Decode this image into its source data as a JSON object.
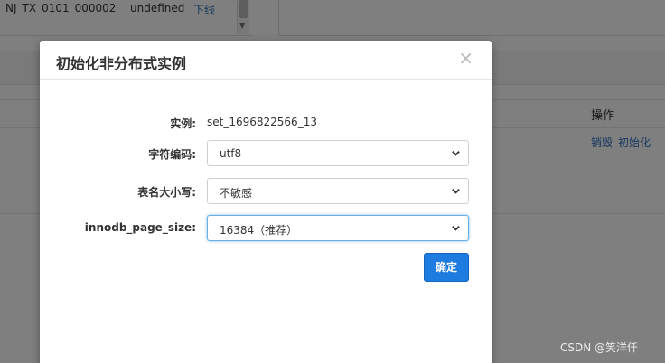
{
  "background": {
    "top_row": {
      "col1": "_NJ_TX_0101_000002",
      "col2": "undefined",
      "col3_link": "下线"
    },
    "table_header_ops": "操作",
    "row_actions": [
      "销毁",
      "初始化"
    ]
  },
  "modal": {
    "title": "初始化非分布式实例",
    "close_symbol": "×",
    "fields": {
      "instance": {
        "label": "实例:",
        "value": "set_1696822566_13"
      },
      "charset": {
        "label": "字符编码:",
        "selected": "utf8"
      },
      "table_case": {
        "label": "表名大小写:",
        "selected": "不敏感"
      },
      "page_size": {
        "label": "innodb_page_size:",
        "selected": "16384（推荐）"
      }
    },
    "confirm_label": "确定"
  },
  "watermark": "CSDN @笑洋仟",
  "colors": {
    "primary_button": "#1e7be0",
    "link": "#2f6fbf",
    "overlay": "rgba(0,0,0,0.5)"
  },
  "icons": {
    "close": "close-icon",
    "dropdown": "chevron-down-icon"
  }
}
